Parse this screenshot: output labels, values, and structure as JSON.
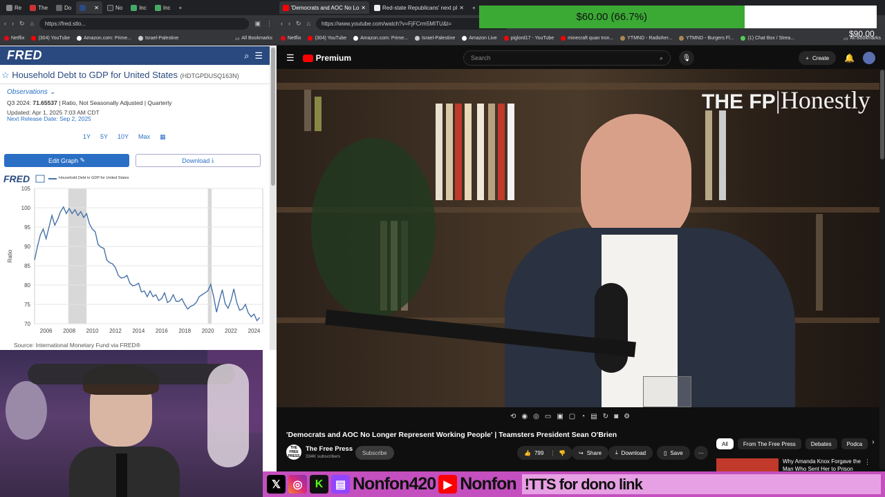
{
  "left_browser": {
    "tabs": [
      {
        "label": "Re"
      },
      {
        "label": "The"
      },
      {
        "label": "Do"
      },
      {
        "label": ""
      },
      {
        "label": "No"
      },
      {
        "label": "Inc"
      },
      {
        "label": "Inc"
      }
    ],
    "url": "https://fred.stlo...",
    "bookmarks": [
      "Netflix",
      "(304) YouTube",
      "Amazon.com: Prime...",
      "Israel-Palestine"
    ],
    "all_bookmarks": "All Bookmarks"
  },
  "fred": {
    "logo": "FRED",
    "series_title": "Household Debt to GDP for United States",
    "series_id": "(HDTGPDUSQ163N)",
    "observations_label": "Observations",
    "obs_period": "Q3 2024:",
    "obs_value": "71.65537",
    "obs_units": "| Ratio, Not Seasonally Adjusted | Quarterly",
    "updated": "Updated: Apr 1, 2025 7:03 AM CDT",
    "next_release": "Next Release Date: Sep 2, 2025",
    "ranges": [
      "1Y",
      "5Y",
      "10Y",
      "Max"
    ],
    "edit_graph": "Edit Graph",
    "download": "Download",
    "source": "Source: International Monetary Fund via FRED®"
  },
  "chart_data": {
    "type": "line",
    "title": "Household Debt to GDP for United States",
    "ylabel": "Ratio",
    "ylim": [
      70,
      105
    ],
    "yticks": [
      70,
      75,
      80,
      85,
      90,
      95,
      100,
      105
    ],
    "xticks": [
      "2006",
      "2008",
      "2010",
      "2012",
      "2014",
      "2016",
      "2018",
      "2020",
      "2022",
      "2024"
    ],
    "recessions": [
      [
        2007.92,
        2009.5
      ],
      [
        2020.0,
        2020.33
      ]
    ],
    "series": [
      {
        "name": "Household Debt to GDP for United States",
        "color": "#4572a7",
        "x": [
          2005.0,
          2005.25,
          2005.5,
          2005.75,
          2006.0,
          2006.25,
          2006.5,
          2006.75,
          2007.0,
          2007.25,
          2007.5,
          2007.75,
          2008.0,
          2008.25,
          2008.5,
          2008.75,
          2009.0,
          2009.25,
          2009.5,
          2009.75,
          2010.0,
          2010.25,
          2010.5,
          2010.75,
          2011.0,
          2011.25,
          2011.5,
          2011.75,
          2012.0,
          2012.25,
          2012.5,
          2012.75,
          2013.0,
          2013.25,
          2013.5,
          2013.75,
          2014.0,
          2014.25,
          2014.5,
          2014.75,
          2015.0,
          2015.25,
          2015.5,
          2015.75,
          2016.0,
          2016.25,
          2016.5,
          2016.75,
          2017.0,
          2017.25,
          2017.5,
          2017.75,
          2018.0,
          2018.25,
          2018.5,
          2018.75,
          2019.0,
          2019.25,
          2019.5,
          2019.75,
          2020.0,
          2020.25,
          2020.5,
          2020.75,
          2021.0,
          2021.25,
          2021.5,
          2021.75,
          2022.0,
          2022.25,
          2022.5,
          2022.75,
          2023.0,
          2023.25,
          2023.5,
          2023.75,
          2024.0,
          2024.25,
          2024.5
        ],
        "values": [
          86.5,
          90,
          93,
          94.5,
          92,
          95,
          98,
          95.5,
          97,
          99,
          100.2,
          98.5,
          99.8,
          98.5,
          99.5,
          98,
          99,
          97.5,
          98.5,
          95.8,
          94.5,
          93.8,
          90.5,
          89.8,
          89.5,
          86.5,
          85.8,
          85.5,
          84.5,
          82.5,
          81.8,
          82,
          82.5,
          80.5,
          79.8,
          80,
          80.5,
          78.2,
          78.5,
          77,
          78.5,
          77,
          77.5,
          76,
          76.5,
          78,
          75.5,
          76,
          77.5,
          75.8,
          75.8,
          76.5,
          75,
          73.8,
          74.5,
          74.8,
          75.5,
          77,
          77.5,
          78,
          78.5,
          80.2,
          77,
          73,
          76,
          78.8,
          75.2,
          74,
          76,
          79,
          75.5,
          73.5,
          73.8,
          75,
          72.8,
          71.8,
          72.5,
          70.8,
          71.65
        ]
      }
    ]
  },
  "right_browser": {
    "tabs": [
      {
        "label": "'Democrats and AOC No Lo"
      },
      {
        "label": "Red-state Republicans' next pl"
      }
    ],
    "url": "https://www.youtube.com/watch?v=FjFCrm5MITU&t=",
    "bookmarks": [
      "Netflix",
      "(304) YouTube",
      "Amazon.com: Prime...",
      "Israel-Palestine",
      "Amazon Live",
      "piglord17 - YouTube",
      "minecraft quan tron...",
      "YTMND - Radioher...",
      "YTMND - Burgers Fl...",
      "(1) Chat Box / Strea..."
    ],
    "all_bookmarks": "All Bookmarks"
  },
  "donation": {
    "amount": "$60.00 (66.7%)",
    "fraction": 0.667,
    "goal": "$90.00",
    "color": "#3aaa35"
  },
  "youtube": {
    "premium_label": "Premium",
    "search_placeholder": "Search",
    "create_label": "Create",
    "watermark_brand": "THE FP",
    "watermark_show": "Honestly",
    "video_title": "'Democrats and AOC No Longer Represent Working People' | Teamsters President Sean O'Brien",
    "channel_name": "The Free Press",
    "subscribers": "334K subscribers",
    "subscribe_label": "Subscribe",
    "likes": "799",
    "share_label": "Share",
    "download_label": "Download",
    "save_label": "Save",
    "chips": [
      "All",
      "From The Free Press",
      "Debates",
      "Podca"
    ],
    "rec_title": "Why Amanda Knox Forgave the Man Who Sent Her to Prison"
  },
  "stream": {
    "handle1": "Nonfon420",
    "handle2": "Nonfon",
    "tts": "!TTS for dono link"
  }
}
